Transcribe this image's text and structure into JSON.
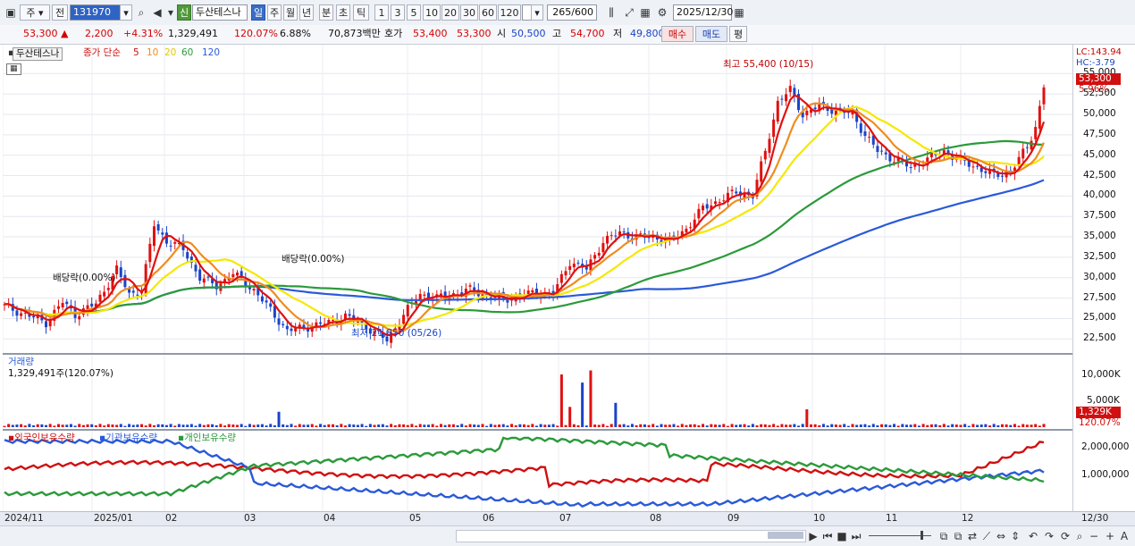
{
  "toolbar": {
    "period_type": "주",
    "prev_label": "전",
    "stock_code": "131970",
    "market_badge": "신",
    "stock_name": "두산테스나",
    "periods": [
      "일",
      "주",
      "월",
      "년",
      "분",
      "초",
      "틱"
    ],
    "active_period": "일",
    "minute_steps": [
      "1",
      "3",
      "5",
      "10",
      "20",
      "30",
      "60",
      "120"
    ],
    "count_display": "265/600",
    "date_value": "2025/12/30"
  },
  "quote": {
    "price": "53,300",
    "change": "2,200",
    "change_pct": "+4.31%",
    "volume": "1,329,491",
    "volume_ratio": "120.07%",
    "turnover": "6.88%",
    "amount": "70,873백만",
    "ask_label": "호가",
    "ask": "53,400",
    "bid": "53,300",
    "open_label": "시",
    "open": "50,500",
    "high_label": "고",
    "high": "54,700",
    "low_label": "저",
    "low": "49,800",
    "buy_button": "매수",
    "sell_button": "매도",
    "eval_button": "평"
  },
  "chart_data": [
    {
      "type": "line",
      "title": "두산테스나",
      "legend": [
        "종가 단순",
        "5",
        "10",
        "20",
        "60",
        "120"
      ],
      "series_colors": {
        "price": "#e01010",
        "5": "#e01010",
        "10": "#f08c1e",
        "20": "#f5e800",
        "60": "#2b9a3a",
        "120": "#2a5ad8"
      },
      "ylim": [
        21000,
        57000
      ],
      "y_ticks": [
        "55,000",
        "52,500",
        "50,000",
        "47,500",
        "45,000",
        "42,500",
        "40,000",
        "37,500",
        "35,000",
        "32,500",
        "30,000",
        "27,500",
        "25,000",
        "22,500"
      ],
      "x_labels": [
        "2024/11",
        "2025/01",
        "02",
        "03",
        "04",
        "05",
        "06",
        "07",
        "08",
        "09",
        "10",
        "11",
        "12",
        "12/30"
      ],
      "annotations": {
        "high": "최고 55,400 (10/15)",
        "low": "최저 21,850 (05/26)",
        "dividend1": "배당락(0.00%)",
        "dividend2": "배당락(0.00%)"
      },
      "last_price": "53,300",
      "last_pct": "5.96%",
      "lc": "LC:143.94",
      "hc": "HC:-3.79",
      "close_knots": [
        [
          0,
          26500
        ],
        [
          5,
          25500
        ],
        [
          10,
          24500
        ],
        [
          14,
          27000
        ],
        [
          17,
          25500
        ],
        [
          22,
          26800
        ],
        [
          27,
          31000
        ],
        [
          30,
          28000
        ],
        [
          33,
          28500
        ],
        [
          36,
          36500
        ],
        [
          39,
          34500
        ],
        [
          43,
          33500
        ],
        [
          47,
          30000
        ],
        [
          51,
          29000
        ],
        [
          55,
          30500
        ],
        [
          60,
          28500
        ],
        [
          64,
          26000
        ],
        [
          68,
          23500
        ],
        [
          73,
          24000
        ],
        [
          78,
          24500
        ],
        [
          82,
          25300
        ],
        [
          87,
          24000
        ],
        [
          92,
          22300
        ],
        [
          96,
          25500
        ],
        [
          100,
          28000
        ],
        [
          104,
          27500
        ],
        [
          108,
          28000
        ],
        [
          112,
          28500
        ],
        [
          116,
          27800
        ],
        [
          120,
          27300
        ],
        [
          124,
          27800
        ],
        [
          128,
          28200
        ],
        [
          132,
          28000
        ],
        [
          136,
          32000
        ],
        [
          140,
          31000
        ],
        [
          144,
          34500
        ],
        [
          148,
          35500
        ],
        [
          152,
          35000
        ],
        [
          156,
          35000
        ],
        [
          160,
          34500
        ],
        [
          164,
          36000
        ],
        [
          168,
          38500
        ],
        [
          172,
          39500
        ],
        [
          176,
          40500
        ],
        [
          180,
          40000
        ],
        [
          183,
          45500
        ],
        [
          186,
          51500
        ],
        [
          189,
          53000
        ],
        [
          192,
          50000
        ],
        [
          196,
          51000
        ],
        [
          200,
          50500
        ],
        [
          204,
          50000
        ],
        [
          207,
          47500
        ],
        [
          210,
          45500
        ],
        [
          214,
          44500
        ],
        [
          218,
          43500
        ],
        [
          222,
          44500
        ],
        [
          226,
          45500
        ],
        [
          230,
          44300
        ],
        [
          234,
          43500
        ],
        [
          238,
          42500
        ],
        [
          242,
          43000
        ],
        [
          246,
          46000
        ],
        [
          248,
          48500
        ],
        [
          250,
          53300
        ]
      ]
    },
    {
      "type": "bar",
      "title": "거래량",
      "subtitle": "1,329,491주(120.07%)",
      "y_ticks": [
        "10,000K",
        "5,000K"
      ],
      "last_value": "1,329K",
      "last_pct": "120.07%",
      "spikes": [
        [
          66,
          1900000
        ],
        [
          134,
          6500000
        ],
        [
          136,
          2500000
        ],
        [
          139,
          5500000
        ],
        [
          141,
          7000000
        ],
        [
          147,
          3000000
        ],
        [
          193,
          2200000
        ]
      ]
    },
    {
      "type": "line",
      "series": [
        {
          "name": "외국인보유수량",
          "color": "#d01010"
        },
        {
          "name": "기관보유수량",
          "color": "#2a5ad8"
        },
        {
          "name": "개인보유수량",
          "color": "#2b9a3a"
        }
      ],
      "y_ticks": [
        "2,000,000",
        "1,000,000"
      ]
    }
  ]
}
